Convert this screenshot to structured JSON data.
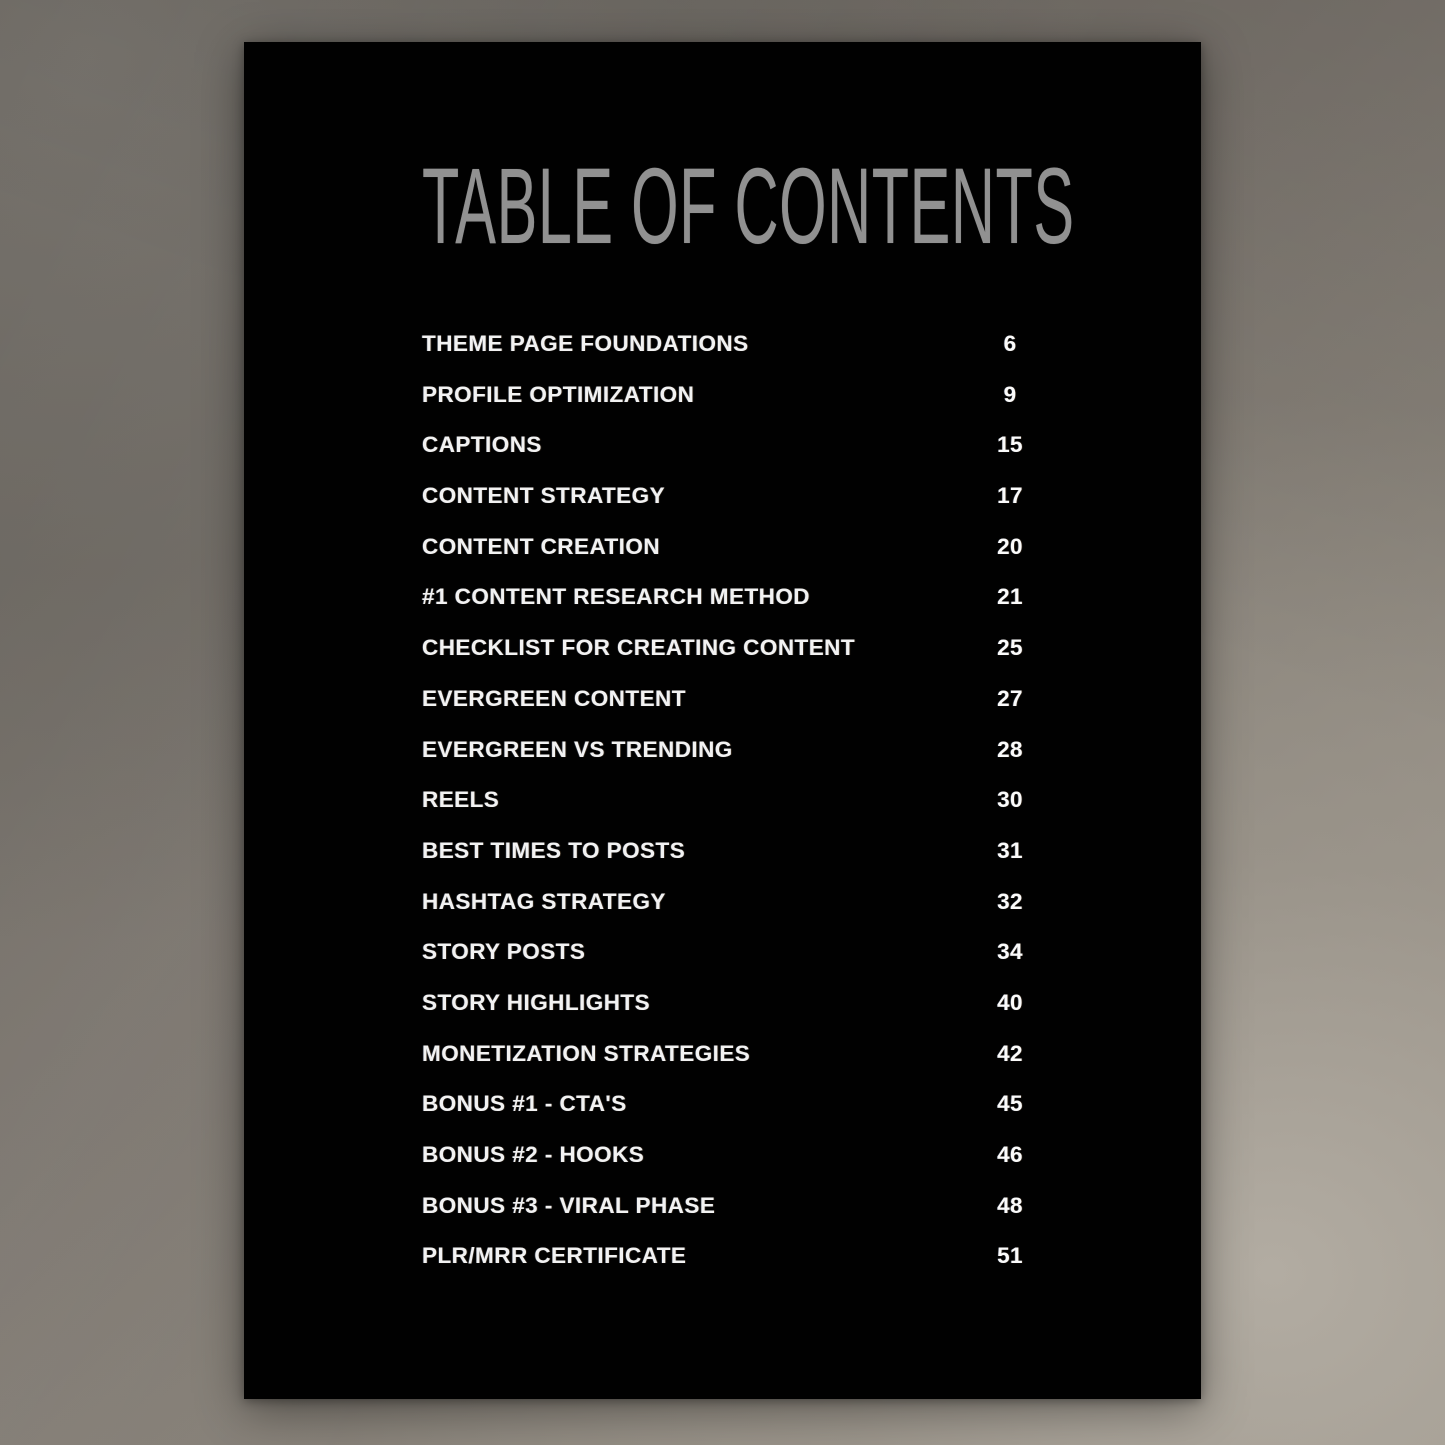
{
  "document": {
    "title": "TABLE OF CONTENTS",
    "card_background": "#010101",
    "title_color": "#919191",
    "entry_color": "#f2f2f2",
    "backdrop_colors": [
      "#6d6861",
      "#8b857c",
      "#a49d92"
    ]
  },
  "toc": {
    "entries": [
      {
        "label": "THEME PAGE FOUNDATIONS",
        "page": "6"
      },
      {
        "label": "PROFILE OPTIMIZATION",
        "page": "9"
      },
      {
        "label": "CAPTIONS",
        "page": "15"
      },
      {
        "label": "CONTENT STRATEGY",
        "page": "17"
      },
      {
        "label": "CONTENT CREATION",
        "page": "20"
      },
      {
        "label": "#1 CONTENT RESEARCH METHOD",
        "page": "21"
      },
      {
        "label": "CHECKLIST FOR CREATING CONTENT",
        "page": "25"
      },
      {
        "label": "EVERGREEN CONTENT",
        "page": "27"
      },
      {
        "label": "EVERGREEN VS TRENDING",
        "page": "28"
      },
      {
        "label": "REELS",
        "page": "30"
      },
      {
        "label": "BEST TIMES TO POSTS",
        "page": "31"
      },
      {
        "label": "HASHTAG STRATEGY",
        "page": "32"
      },
      {
        "label": "STORY POSTS",
        "page": "34"
      },
      {
        "label": "STORY HIGHLIGHTS",
        "page": "40"
      },
      {
        "label": "MONETIZATION STRATEGIES",
        "page": "42"
      },
      {
        "label": "BONUS #1 - CTA'S",
        "page": "45"
      },
      {
        "label": "BONUS #2 - HOOKS",
        "page": "46"
      },
      {
        "label": "BONUS #3 - VIRAL PHASE",
        "page": "48"
      },
      {
        "label": "PLR/MRR CERTIFICATE",
        "page": "51"
      }
    ]
  }
}
